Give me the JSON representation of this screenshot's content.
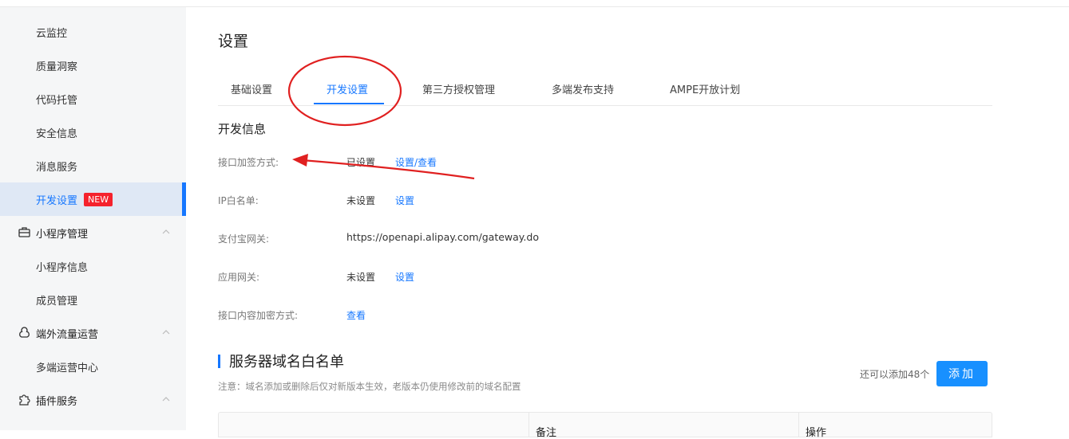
{
  "sidebar": {
    "items": [
      {
        "label": "云监控"
      },
      {
        "label": "质量洞察"
      },
      {
        "label": "代码托管"
      },
      {
        "label": "安全信息"
      },
      {
        "label": "消息服务"
      },
      {
        "label": "开发设置",
        "badge": "NEW",
        "active": true
      }
    ],
    "groups": [
      {
        "label": "小程序管理",
        "icon": "briefcase-icon",
        "children": [
          {
            "label": "小程序信息"
          },
          {
            "label": "成员管理"
          }
        ]
      },
      {
        "label": "端外流量运营",
        "icon": "flow-icon",
        "children": [
          {
            "label": "多端运营中心"
          }
        ]
      },
      {
        "label": "插件服务",
        "icon": "puzzle-icon",
        "children": []
      }
    ]
  },
  "page": {
    "title": "设置",
    "tabs": [
      {
        "label": "基础设置"
      },
      {
        "label": "开发设置",
        "active": true
      },
      {
        "label": "第三方授权管理"
      },
      {
        "label": "多端发布支持"
      },
      {
        "label": "AMPE开放计划"
      }
    ]
  },
  "dev_info": {
    "heading": "开发信息",
    "rows": [
      {
        "label": "接口加签方式:",
        "value": "已设置",
        "link": "设置/查看"
      },
      {
        "label": "IP白名单:",
        "value": "未设置",
        "link": "设置"
      },
      {
        "label": "支付宝网关:",
        "value": "https://openapi.alipay.com/gateway.do"
      },
      {
        "label": "应用网关:",
        "value": "未设置",
        "link": "设置"
      },
      {
        "label": "接口内容加密方式:",
        "link": "查看"
      }
    ]
  },
  "domain_whitelist": {
    "title": "服务器域名白名单",
    "note": "注意：域名添加或删除后仅对新版本生效，老版本仍使用修改前的域名配置",
    "remaining": "还可以添加48个",
    "add_button": "添加",
    "columns": [
      "",
      "备注",
      "操作"
    ]
  },
  "colors": {
    "accent": "#1677ff",
    "button": "#1890ff",
    "badge": "#f5222d",
    "annotation": "#e02020",
    "sidebar_bg": "#f5f6f7",
    "sidebar_active_bg": "#dfe8f5"
  }
}
